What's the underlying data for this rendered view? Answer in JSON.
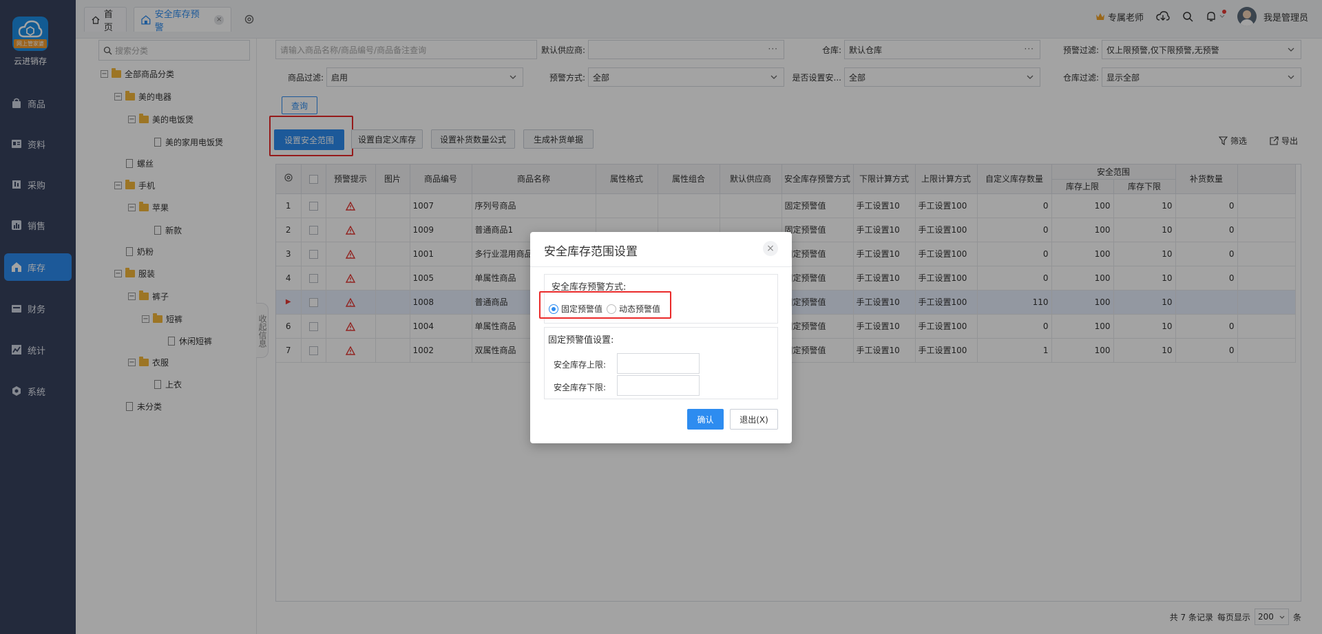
{
  "sidebar": {
    "logo_tag": "网上管家婆",
    "brand": "云进销存",
    "items": [
      {
        "label": "商品",
        "icon": "bag-icon"
      },
      {
        "label": "资料",
        "icon": "profile-icon"
      },
      {
        "label": "采购",
        "icon": "purchase-icon"
      },
      {
        "label": "销售",
        "icon": "sales-chart-icon"
      },
      {
        "label": "库存",
        "icon": "warehouse-icon"
      },
      {
        "label": "财务",
        "icon": "wallet-icon"
      },
      {
        "label": "统计",
        "icon": "trend-icon"
      },
      {
        "label": "系统",
        "icon": "hexagon-gear-icon"
      }
    ],
    "active": "库存"
  },
  "tabs": [
    {
      "label": "首页"
    },
    {
      "label": "安全库存预警",
      "close": "×"
    }
  ],
  "topbar": {
    "advisor": "专属老师",
    "user": "我是管理员"
  },
  "tree": {
    "search_placeholder": "搜索分类",
    "nodes": [
      {
        "label": "全部商品分类",
        "toggle": "−"
      },
      {
        "label": "美的电器",
        "toggle": "−"
      },
      {
        "label": "美的电饭煲",
        "toggle": "−"
      },
      {
        "label": "美的家用电饭煲"
      },
      {
        "label": "螺丝"
      },
      {
        "label": "手机",
        "toggle": "−"
      },
      {
        "label": "苹果",
        "toggle": "−"
      },
      {
        "label": "新款"
      },
      {
        "label": "奶粉"
      },
      {
        "label": "服装",
        "toggle": "−"
      },
      {
        "label": "裤子",
        "toggle": "−"
      },
      {
        "label": "短裤",
        "toggle": "−"
      },
      {
        "label": "休闲短裤"
      },
      {
        "label": "衣服",
        "toggle": "−"
      },
      {
        "label": "上衣"
      },
      {
        "label": "未分类"
      }
    ],
    "collapse_label": "收起信息"
  },
  "filters": {
    "search_placeholder": "请输入商品名称/商品编号/商品备注查询",
    "supplier_label": "默认供应商:",
    "supplier_value": "",
    "supplier_more": "···",
    "warehouse_label": "仓库:",
    "warehouse_value": "默认仓库",
    "warehouse_more": "···",
    "alert_filter_label": "预警过滤:",
    "alert_filter_value": "仅上限预警,仅下限预警,无预警",
    "product_filter_label": "商品过滤:",
    "product_filter_value": "启用",
    "alert_mode_label": "预警方式:",
    "alert_mode_value": "全部",
    "is_set_label": "是否设置安...",
    "is_set_value": "全部",
    "warehouse_filter_label": "仓库过滤:",
    "warehouse_filter_value": "显示全部",
    "query_button": "查询"
  },
  "toolbar": {
    "set_range": "设置安全范围",
    "set_custom": "设置自定义库存",
    "set_formula": "设置补货数量公式",
    "generate": "生成补货单据",
    "filter": "筛选",
    "export": "导出"
  },
  "table": {
    "headers": {
      "alert": "预警提示",
      "image": "图片",
      "code": "商品编号",
      "name": "商品名称",
      "attr_spec": "属性格式",
      "attr_combo": "属性组合",
      "supplier": "默认供应商",
      "alert_mode": "安全库存预警方式",
      "lower_calc": "下限计算方式",
      "upper_calc": "上限计算方式",
      "custom_qty": "自定义库存数量",
      "safe_range": "安全范围",
      "upper": "库存上限",
      "lower": "库存下限",
      "replenish": "补货数量"
    },
    "rows": [
      {
        "idx": "1",
        "code": "1007",
        "name": "序列号商品",
        "mode": "固定预警值",
        "lower_calc": "手工设置10",
        "upper_calc": "手工设置100",
        "custom": "0",
        "upper": "100",
        "lower": "10",
        "replenish": "0"
      },
      {
        "idx": "2",
        "code": "1009",
        "name": "普通商品1",
        "mode": "固定预警值",
        "lower_calc": "手工设置10",
        "upper_calc": "手工设置100",
        "custom": "0",
        "upper": "100",
        "lower": "10",
        "replenish": "0"
      },
      {
        "idx": "3",
        "code": "1001",
        "name": "多行业混用商品",
        "mode": "固定预警值",
        "lower_calc": "手工设置10",
        "upper_calc": "手工设置100",
        "custom": "0",
        "upper": "100",
        "lower": "10",
        "replenish": "0"
      },
      {
        "idx": "4",
        "code": "1005",
        "name": "单属性商品",
        "mode": "固定预警值",
        "lower_calc": "手工设置10",
        "upper_calc": "手工设置100",
        "custom": "0",
        "upper": "100",
        "lower": "10",
        "replenish": "0"
      },
      {
        "idx": "▶",
        "code": "1008",
        "name": "普通商品",
        "mode": "固定预警值",
        "lower_calc": "手工设置10",
        "upper_calc": "手工设置100",
        "custom": "110",
        "upper": "100",
        "lower": "10",
        "replenish": ""
      },
      {
        "idx": "6",
        "code": "1004",
        "name": "单属性商品",
        "mode": "固定预警值",
        "lower_calc": "手工设置10",
        "upper_calc": "手工设置100",
        "custom": "0",
        "upper": "100",
        "lower": "10",
        "replenish": "0"
      },
      {
        "idx": "7",
        "code": "1002",
        "name": "双属性商品",
        "mode": "固定预警值",
        "lower_calc": "手工设置10",
        "upper_calc": "手工设置100",
        "custom": "1",
        "upper": "100",
        "lower": "10",
        "replenish": "0"
      }
    ],
    "selected_row": 4
  },
  "footer": {
    "total": "共 7 条记录",
    "per_page_label": "每页显示",
    "per_page_value": "200",
    "unit": "条"
  },
  "dialog": {
    "title": "安全库存范围设置",
    "close": "×",
    "mode_label": "安全库存预警方式:",
    "option_fixed": "固定预警值",
    "option_dynamic": "动态预警值",
    "selected": "fixed",
    "fixed_section": "固定预警值设置:",
    "upper_label": "安全库存上限:",
    "lower_label": "安全库存下限:",
    "upper_value": "",
    "lower_value": "",
    "confirm": "确认",
    "exit": "退出(X)"
  }
}
